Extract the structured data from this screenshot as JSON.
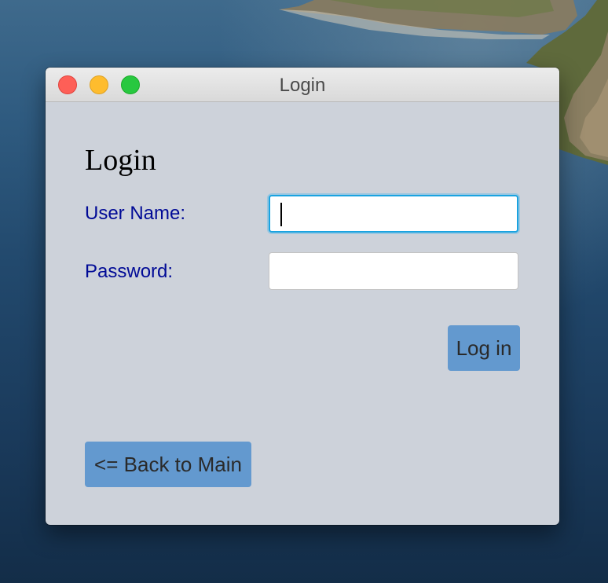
{
  "window": {
    "title": "Login",
    "traffic_lights": {
      "close": "#fe5f57",
      "minimize": "#febc2e",
      "zoom": "#28c840"
    }
  },
  "form": {
    "heading": "Login",
    "username": {
      "label": "User Name:",
      "value": "",
      "focused": true
    },
    "password": {
      "label": "Password:",
      "value": ""
    },
    "login_button_label": "Log in",
    "back_button_label": "<= Back to Main"
  },
  "colors": {
    "window_background": "#cdd2da",
    "label_color": "#000a96",
    "button_background": "#6399cf",
    "focus_ring": "#1aa3e0"
  }
}
